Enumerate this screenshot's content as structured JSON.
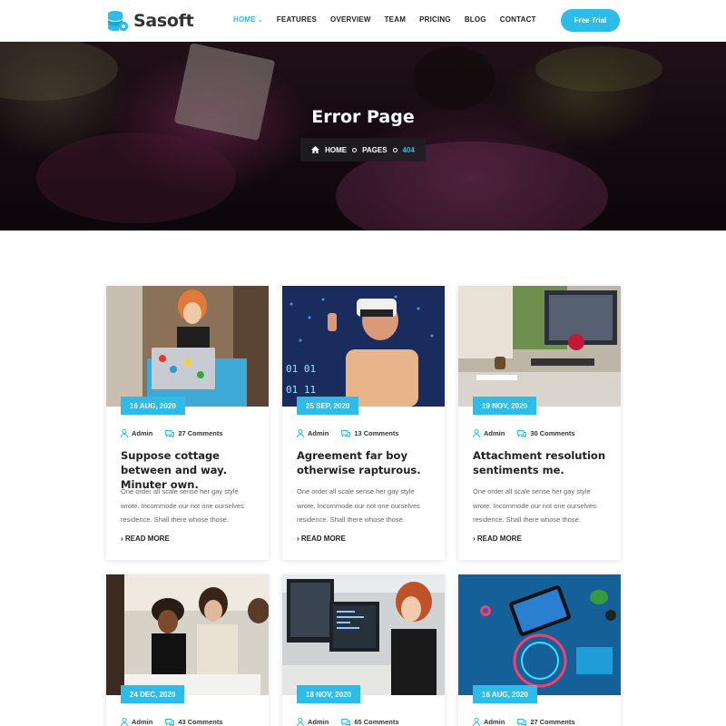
{
  "brand": {
    "name": "Sasoft"
  },
  "nav": {
    "items": [
      {
        "label": "HOME",
        "active": true,
        "has_dropdown": true
      },
      {
        "label": "FEATURES"
      },
      {
        "label": "OVERVIEW"
      },
      {
        "label": "TEAM"
      },
      {
        "label": "PRICING"
      },
      {
        "label": "BLOG"
      },
      {
        "label": "CONTACT"
      }
    ],
    "cta_label": "Free Trial"
  },
  "hero": {
    "title": "Error Page",
    "breadcrumb": {
      "home": "HOME",
      "pages": "PAGES",
      "current": "404"
    }
  },
  "colors": {
    "accent": "#2dbbe8",
    "text": "#222222",
    "muted": "#666666"
  },
  "posts": [
    {
      "date": "16 AUG, 2020",
      "author": "Admin",
      "comments": "27 Comments",
      "title": "Suppose cottage between and way. Minuter own.",
      "excerpt": "One order all scale sense her gay style wrote. Incommode our not one ourselves residence. Shall there whose those.",
      "read_more": "READ MORE"
    },
    {
      "date": "25 SEP, 2020",
      "author": "Admin",
      "comments": "13 Comments",
      "title": "Agreement far boy otherwise rapturous.",
      "excerpt": "One order all scale sense her gay style wrote. Incommode our not one ourselves residence. Shall there whose those.",
      "read_more": "READ MORE"
    },
    {
      "date": "19 NOV, 2020",
      "author": "Admin",
      "comments": "30 Comments",
      "title": "Attachment resolution sentiments me.",
      "excerpt": "One order all scale sense her gay style wrote. Incommode our not one ourselves residence. Shall there whose those.",
      "read_more": "READ MORE"
    },
    {
      "date": "24 DEC, 2020",
      "author": "Admin",
      "comments": "43 Comments"
    },
    {
      "date": "18 NOV, 2020",
      "author": "Admin",
      "comments": "65 Comments"
    },
    {
      "date": "16 AUG, 2020",
      "author": "Admin",
      "comments": "27 Comments"
    }
  ]
}
